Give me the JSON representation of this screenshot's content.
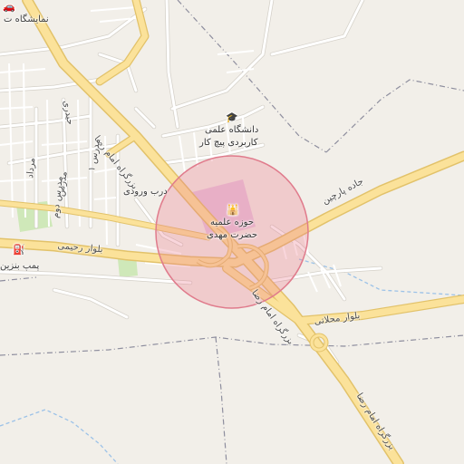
{
  "map": {
    "colors": {
      "background": "#f2efe9",
      "major_road_fill": "#fbe29a",
      "major_road_casing": "#e2c26a",
      "minor_road": "#ffffff",
      "minor_road_casing": "#d4d0c8",
      "boundary": "#8e8e9e",
      "water": "#9cc2e8",
      "park": "#cfe8b9",
      "campus": "#e7c7e0",
      "highlight_circle_fill": "rgba(236,120,140,0.30)",
      "highlight_circle_stroke": "#e07b8c"
    },
    "highlight_circle": {
      "center_latlon_note": "",
      "radius_meters": null
    }
  },
  "labels": {
    "exhibition": "نمایشگاه ت",
    "university": "دانشگاه علمی",
    "university_2": "کاربردی پیچ کار",
    "seminary": "حوزه علمیه",
    "seminary_2": "حضرت مهدی",
    "entrance_gate": "درب ورودی",
    "fuel_station": "پمپ بنزین",
    "imam_reza_hwy_north": "بزرگراه امام رضا",
    "imam_reza_hwy_mid": "بزرگراه امام رضا",
    "imam_reza_hwy_south": "بزرگراه امام رضا",
    "parchin_road": "جاده پارچین",
    "mahallati_blvd": "بلوار محلاتی",
    "rahimi_blvd": "بلوار رحیمی",
    "hazrati_st": "حیدری",
    "modares_st": "مدرس",
    "modares_1": "مدرس ۱",
    "modares_2": "مدرس دوم",
    "mordad_st": "مرداد"
  },
  "icons": {
    "car": "car-icon",
    "graduation_cap": "graduation-cap-icon",
    "place_of_worship": "mosque-icon",
    "fuel": "fuel-icon"
  }
}
